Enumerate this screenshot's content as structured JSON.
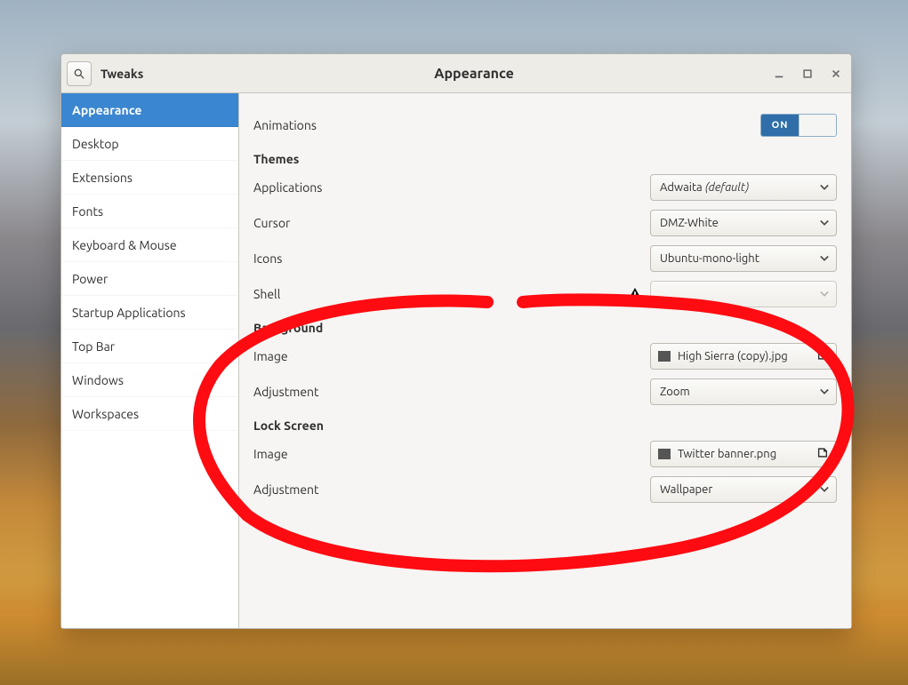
{
  "colors": {
    "accent": "#2f6ea8",
    "sidebar_active": "#3b86d0",
    "annotation": "#ff0b12"
  },
  "titlebar": {
    "app_title": "Tweaks",
    "page_title": "Appearance"
  },
  "sidebar": {
    "items": [
      {
        "label": "Appearance",
        "active": true
      },
      {
        "label": "Desktop"
      },
      {
        "label": "Extensions"
      },
      {
        "label": "Fonts"
      },
      {
        "label": "Keyboard & Mouse"
      },
      {
        "label": "Power"
      },
      {
        "label": "Startup Applications"
      },
      {
        "label": "Top Bar"
      },
      {
        "label": "Windows"
      },
      {
        "label": "Workspaces"
      }
    ]
  },
  "pane": {
    "animations": {
      "label": "Animations",
      "toggle_on_label": "ON"
    },
    "themes": {
      "heading": "Themes",
      "applications": {
        "label": "Applications",
        "value": "Adwaita",
        "default_suffix": "(default)"
      },
      "cursor": {
        "label": "Cursor",
        "value": "DMZ-White"
      },
      "icons": {
        "label": "Icons",
        "value": "Ubuntu-mono-light"
      },
      "shell": {
        "label": "Shell",
        "value": ""
      }
    },
    "background": {
      "heading": "Background",
      "image": {
        "label": "Image",
        "filename": "High Sierra (copy).jpg"
      },
      "adjustment": {
        "label": "Adjustment",
        "value": "Zoom"
      }
    },
    "lockscreen": {
      "heading": "Lock Screen",
      "image": {
        "label": "Image",
        "filename": "Twitter banner.png"
      },
      "adjustment": {
        "label": "Adjustment",
        "value": "Wallpaper"
      }
    }
  }
}
